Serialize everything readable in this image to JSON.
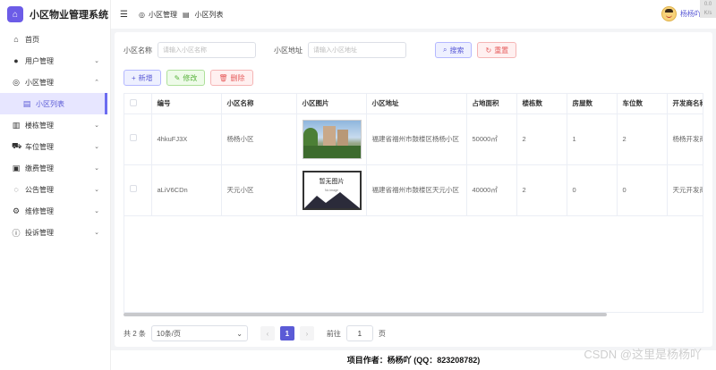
{
  "app": {
    "title": "小区物业管理系统"
  },
  "header": {
    "breadcrumb": [
      "小区管理",
      "小区列表"
    ],
    "user_name": "杨杨吖",
    "corner_text": "0.0 K/s"
  },
  "sidebar": {
    "items": [
      {
        "label": "首页",
        "icon": "home-icon",
        "glyph": "⌂"
      },
      {
        "label": "用户管理",
        "icon": "user-icon",
        "glyph": "●"
      },
      {
        "label": "小区管理",
        "icon": "community-icon",
        "glyph": "◎"
      },
      {
        "label": "小区列表",
        "icon": "list-icon",
        "glyph": "▤"
      },
      {
        "label": "楼栋管理",
        "icon": "building-icon",
        "glyph": "▥"
      },
      {
        "label": "车位管理",
        "icon": "car-icon",
        "glyph": "⛟"
      },
      {
        "label": "缴费管理",
        "icon": "wallet-icon",
        "glyph": "▣"
      },
      {
        "label": "公告管理",
        "icon": "notice-icon",
        "glyph": "◌"
      },
      {
        "label": "维修管理",
        "icon": "repair-icon",
        "glyph": "⚙"
      },
      {
        "label": "投诉管理",
        "icon": "complaint-icon",
        "glyph": "ⓘ"
      }
    ]
  },
  "search": {
    "name_label": "小区名称",
    "name_placeholder": "请输入小区名称",
    "address_label": "小区地址",
    "address_placeholder": "请输入小区地址",
    "search_btn": "搜索",
    "reset_btn": "重置"
  },
  "actions": {
    "add": "新增",
    "edit": "修改",
    "delete": "删除"
  },
  "table": {
    "headers": [
      "编号",
      "小区名称",
      "小区图片",
      "小区地址",
      "占地面积",
      "楼栋数",
      "房屋数",
      "车位数",
      "开发商名称"
    ],
    "rows": [
      {
        "id": "4hkuFJ3X",
        "name": "杨杨小区",
        "address": "福建省福州市鼓楼区杨杨小区",
        "area": "50000㎡",
        "buildings": "2",
        "houses": "1",
        "parking": "2",
        "developer": "杨杨开发商"
      },
      {
        "id": "aLiV6CDn",
        "name": "天元小区",
        "address": "福建省福州市鼓楼区天元小区",
        "area": "40000㎡",
        "buildings": "2",
        "houses": "0",
        "parking": "0",
        "developer": "天元开发商"
      }
    ],
    "no_image_title": "暂无图片",
    "no_image_sub": "No image"
  },
  "pagination": {
    "total": "共 2 条",
    "page_size": "10条/页",
    "current": "1",
    "goto_label": "前往",
    "goto_value": "1",
    "page_unit": "页"
  },
  "footer": {
    "text": "项目作者：杨杨吖 (QQ：823208782)"
  },
  "watermark": "CSDN @这里是杨杨吖"
}
